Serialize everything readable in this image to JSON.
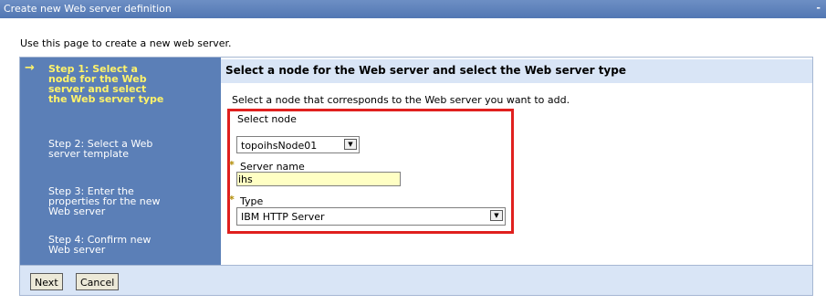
{
  "window": {
    "title": "Create new Web server definition",
    "minimize_label": "-"
  },
  "intro": "Use this page to create a new web server.",
  "steps": [
    {
      "label": "Step 1: Select a node for the Web server and select the Web server type",
      "active": true
    },
    {
      "label": "Step 2: Select a Web server template",
      "active": false
    },
    {
      "label": "Step 3: Enter the properties for the new Web server",
      "active": false
    },
    {
      "label": "Step 4: Confirm new Web server",
      "active": false
    }
  ],
  "step_arrow": "→",
  "main": {
    "heading": "Select a node for the Web server and select the Web server type",
    "instruction": "Select a node that corresponds to the Web server you want to add."
  },
  "form": {
    "node": {
      "label": "Select node",
      "value": "topoihsNode01"
    },
    "server_name": {
      "required_marker": "*",
      "label": "Server name",
      "value": "ihs"
    },
    "type": {
      "required_marker": "*",
      "label": "Type",
      "value": "IBM HTTP Server"
    }
  },
  "buttons": {
    "next": "Next",
    "cancel": "Cancel"
  },
  "icons": {
    "dropdown": "chevron-down-icon",
    "arrow": "arrow-right-icon"
  },
  "colors": {
    "title_bar": "#5b7fb7",
    "steps_panel": "#5b7fb7",
    "active_step": "#fff36a",
    "highlight_box": "#e0201e",
    "input_bg": "#ffffc4"
  }
}
